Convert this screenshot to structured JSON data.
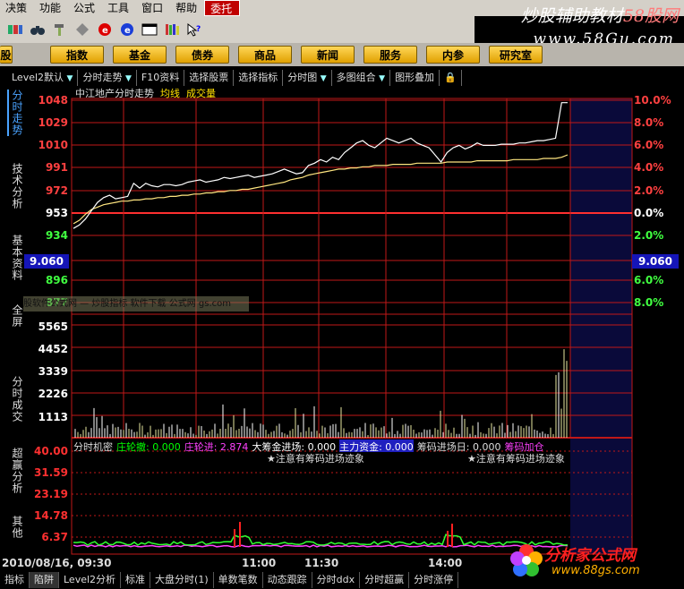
{
  "menu": {
    "items": [
      "决策",
      "功能",
      "公式",
      "工具",
      "窗口",
      "帮助",
      "委托"
    ],
    "active": "委托"
  },
  "brand": {
    "text_main": "炒股辅助教材",
    "text_accent": "58股网",
    "url": "www.58Gu.com"
  },
  "toolbar": {
    "icons": [
      "blocks-icon",
      "binoculars-icon",
      "hammer-icon",
      "red-disc-icon",
      "blue-disc-icon",
      "window-icon",
      "books-icon",
      "help-pointer-icon"
    ]
  },
  "nav": {
    "items": [
      "股",
      "指数",
      "基金",
      "债券",
      "商品",
      "新闻",
      "服务",
      "内参",
      "研究室"
    ]
  },
  "tabs": [
    {
      "label": "Level2默认",
      "arrow": true
    },
    {
      "label": "分时走势",
      "arrow": true
    },
    {
      "label": "F10资料",
      "arrow": false
    },
    {
      "label": "选择股票",
      "arrow": false
    },
    {
      "label": "选择指标",
      "arrow": false
    },
    {
      "label": "分时图",
      "arrow": true
    },
    {
      "label": "多图组合",
      "arrow": true
    },
    {
      "label": "图形叠加",
      "arrow": false
    },
    {
      "label": "🔒",
      "arrow": false
    }
  ],
  "side_tabs": [
    "分时走势",
    "技术分析",
    "基本资料",
    "全屏",
    "分时成交",
    "超赢分析",
    "其他"
  ],
  "chart": {
    "title": "中江地产分时走势",
    "ma_label": "均线",
    "vol_label": "成交量",
    "current_price": "9.060",
    "overlay_text": "股软件公式网 — 炒股指标 软件下载 公式网 gs.com",
    "colors": {
      "price_line": "#ffffff",
      "avg_line": "#ffe680",
      "grid": "#c01818",
      "up": "#ff3030",
      "down": "#00e000",
      "base": "#ffffff"
    }
  },
  "chart_data": {
    "type": "line",
    "title": "中江地产分时走势",
    "price_ticks": [
      "1048",
      "1029",
      "1010",
      "991",
      "972",
      "953",
      "934",
      "9.060",
      "896",
      "877"
    ],
    "pct_ticks": [
      "10.0%",
      "8.0%",
      "6.0%",
      "4.0%",
      "2.0%",
      "0.0%",
      "2.0%",
      "9.060",
      "6.0%",
      "8.0%"
    ],
    "volume_ticks": [
      "5565",
      "4452",
      "3339",
      "2226",
      "1113"
    ],
    "indicator_ticks": [
      "40.00",
      "31.59",
      "23.19",
      "14.78",
      "6.37"
    ],
    "time_ticks": [
      "2010/08/16, 09:30",
      "11:00",
      "11:30",
      "14:00"
    ],
    "series": [
      {
        "name": "分时走势",
        "values": [
          940,
          943,
          948,
          955,
          962,
          966,
          968,
          965,
          966,
          967,
          978,
          974,
          978,
          976,
          975,
          977,
          977,
          976,
          977,
          979,
          980,
          981,
          979,
          980,
          981,
          983,
          982,
          983,
          984,
          985,
          983,
          984,
          985,
          986,
          988,
          990,
          988,
          986,
          987,
          993,
          995,
          998,
          996,
          1000,
          998,
          1004,
          1008,
          1012,
          1014,
          1010,
          1008,
          1012,
          1016,
          1014,
          1012,
          1014,
          1016,
          1012,
          1010,
          1008,
          1002,
          996,
          1004,
          1008,
          1010,
          1007,
          1009,
          1012,
          1010,
          1010,
          1010,
          1011,
          1011,
          1011,
          1012,
          1012,
          1013,
          1014,
          1014,
          1015,
          1016,
          1046,
          1046
        ]
      },
      {
        "name": "均线",
        "values": [
          944,
          947,
          952,
          956,
          958,
          960,
          961,
          962,
          963,
          963,
          964,
          964,
          965,
          965,
          966,
          966,
          967,
          967,
          968,
          968,
          969,
          969,
          970,
          970,
          971,
          971,
          972,
          972,
          973,
          973,
          974,
          975,
          976,
          977,
          978,
          979,
          981,
          982,
          983,
          985,
          986,
          987,
          988,
          989,
          990,
          990,
          991,
          991,
          992,
          992,
          993,
          993,
          993,
          994,
          994,
          994,
          994,
          995,
          995,
          995,
          995,
          995,
          996,
          996,
          996,
          996,
          996,
          997,
          997,
          997,
          997,
          997,
          997,
          998,
          998,
          998,
          998,
          998,
          999,
          999,
          999,
          1000,
          1002
        ]
      }
    ],
    "indicator_legend": [
      {
        "label": "分时机密",
        "color": "#dddddd"
      },
      {
        "label": "庄轮撤: 0.000",
        "color": "#00ff00"
      },
      {
        "label": "庄轮进: 2.874",
        "color": "#ff40ff"
      },
      {
        "label": "大筹金进场: 0.000",
        "color": "#ffffff"
      },
      {
        "label": "主力资金: 0.000",
        "color": "#4040ff"
      },
      {
        "label": "筹码进场日: 0.000",
        "color": "#dddddd"
      },
      {
        "label": "筹码加仓",
        "color": "#ff40ff"
      }
    ],
    "alerts": [
      "★注意有筹码进场迹象",
      "★注意有筹码进场迹象"
    ]
  },
  "bottom_tabs": [
    "指标",
    "陷阱",
    "Level2分析",
    "标准",
    "大盘分时(1)",
    "单数笔数",
    "动态跟踪",
    "分时ddx",
    "分时超赢",
    "分时涨停"
  ],
  "logo": {
    "text": "分析家公式网",
    "url": "www.88gs.com"
  }
}
